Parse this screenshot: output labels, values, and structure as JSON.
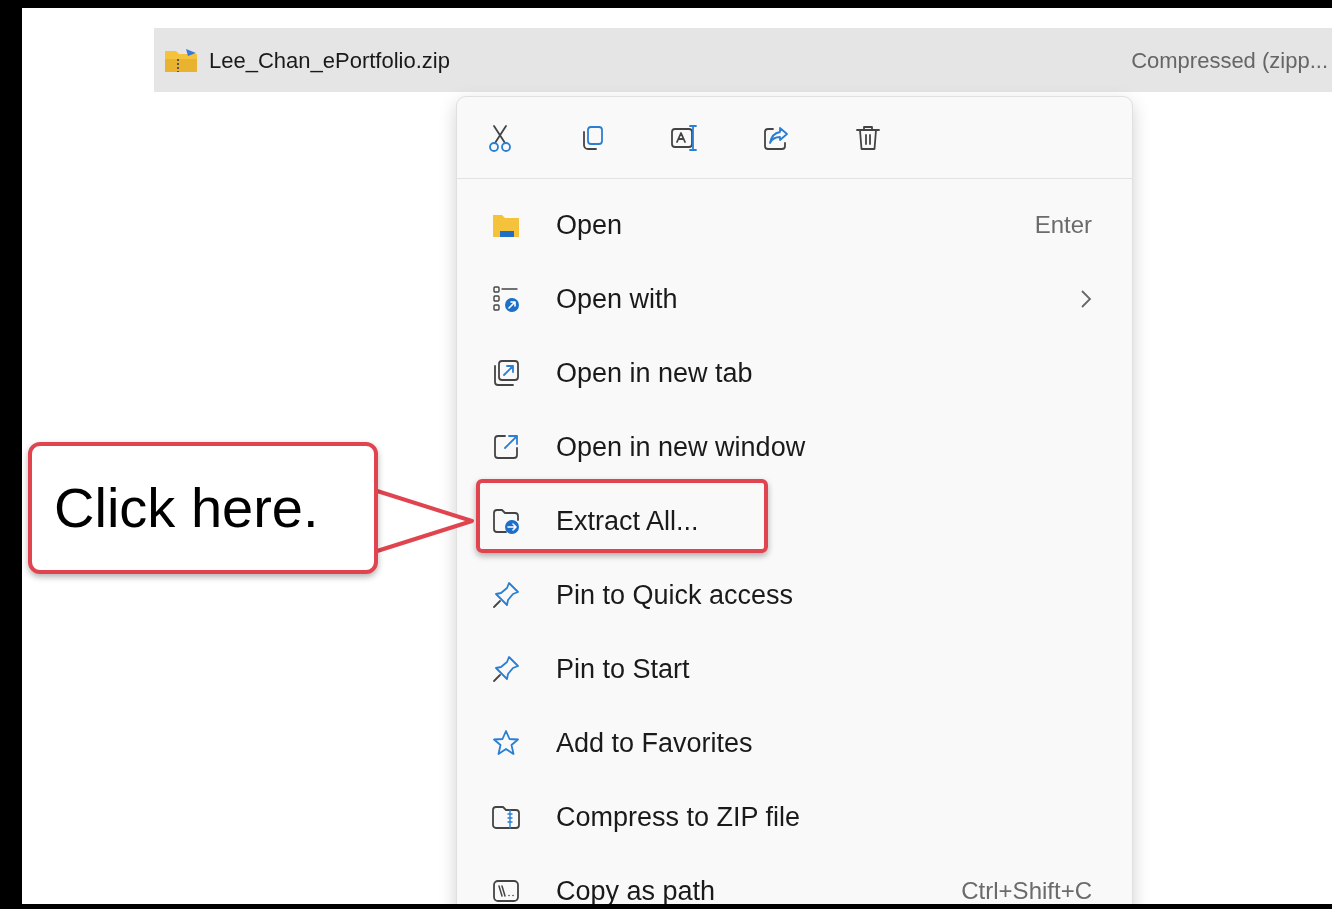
{
  "file_row": {
    "name": "Lee_Chan_ePortfolio.zip",
    "type": "Compressed (zipp...",
    "selected": true
  },
  "context_menu": {
    "items": [
      {
        "label": "Open",
        "shortcut": "Enter",
        "submenu": false
      },
      {
        "label": "Open with",
        "submenu": true
      },
      {
        "label": "Open in new tab",
        "submenu": false
      },
      {
        "label": "Open in new window",
        "submenu": false
      },
      {
        "label": "Extract All...",
        "submenu": false,
        "highlighted": true
      },
      {
        "label": "Pin to Quick access",
        "submenu": false
      },
      {
        "label": "Pin to Start",
        "submenu": false
      },
      {
        "label": "Add to Favorites",
        "submenu": false
      },
      {
        "label": "Compress to ZIP file",
        "submenu": false
      },
      {
        "label": "Copy as path",
        "shortcut": "Ctrl+Shift+C",
        "submenu": false
      }
    ]
  },
  "callout": {
    "text": "Click here."
  }
}
